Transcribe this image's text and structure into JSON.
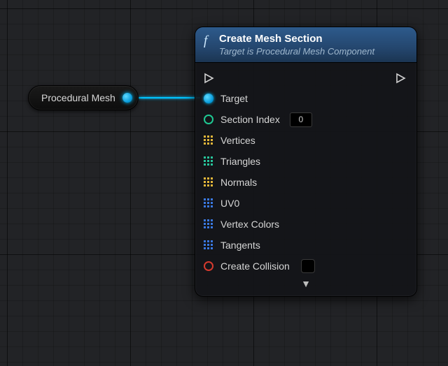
{
  "source_node": {
    "label": "Procedural Mesh"
  },
  "node": {
    "title": "Create Mesh Section",
    "subtitle": "Target is Procedural Mesh Component",
    "pins": {
      "target": "Target",
      "section_index": "Section Index",
      "section_index_value": "0",
      "vertices": "Vertices",
      "triangles": "Triangles",
      "normals": "Normals",
      "uv0": "UV0",
      "vertex_colors": "Vertex Colors",
      "tangents": "Tangents",
      "create_collision": "Create Collision"
    }
  }
}
